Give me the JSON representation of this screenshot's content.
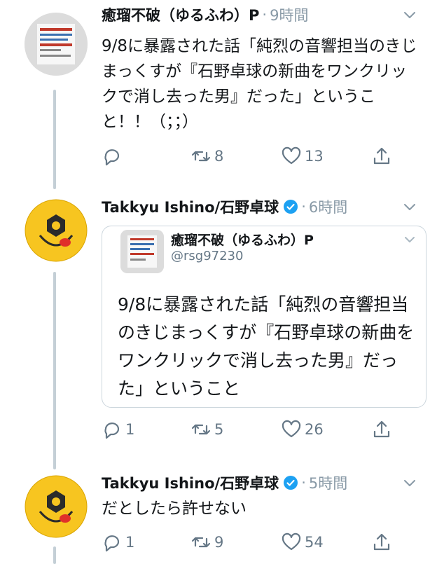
{
  "tweets": [
    {
      "author": "癒瑠不破（ゆるふわ）P",
      "sep": "·",
      "time": "9時間",
      "text": "9/8に暴露された話「純烈の音響担当のきじまっくすが『石野卓球の新曲をワンクリックで消し去った男』だった」ということ！！（；；）",
      "replies": "",
      "retweets": "8",
      "likes": "13"
    },
    {
      "author": "Takkyu Ishino/石野卓球",
      "sep": "·",
      "time": "6時間",
      "quote": {
        "author": "癒瑠不破（ゆるふわ）P",
        "handle": "@rsg97230",
        "text": "9/8に暴露された話「純烈の音響担当のきじまっくすが『石野卓球の新曲をワンクリックで消し去った男』だった」ということ"
      },
      "replies": "1",
      "retweets": "5",
      "likes": "26"
    },
    {
      "author": "Takkyu Ishino/石野卓球",
      "sep": "·",
      "time": "5時間",
      "text": "だとしたら許せない",
      "replies": "1",
      "retweets": "9",
      "likes": "54"
    }
  ],
  "colors": {
    "muted": "#657786",
    "verified": "#1da1f2",
    "thread_line": "#c4cfd6",
    "smiley_yellow": "#f7c520"
  },
  "icons": [
    "reply-icon",
    "retweet-icon",
    "like-icon",
    "share-icon",
    "verified-icon",
    "chevron-down-icon"
  ]
}
